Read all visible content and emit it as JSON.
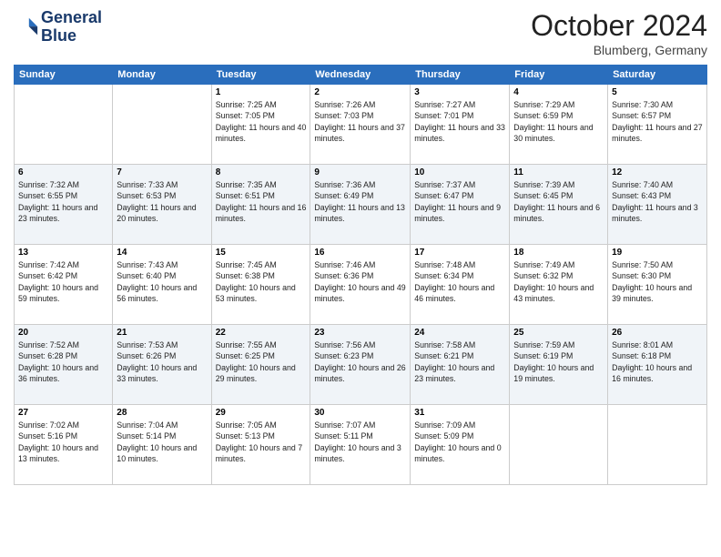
{
  "header": {
    "logo_line1": "General",
    "logo_line2": "Blue",
    "month": "October 2024",
    "location": "Blumberg, Germany"
  },
  "days_of_week": [
    "Sunday",
    "Monday",
    "Tuesday",
    "Wednesday",
    "Thursday",
    "Friday",
    "Saturday"
  ],
  "weeks": [
    [
      {
        "day": "",
        "info": ""
      },
      {
        "day": "",
        "info": ""
      },
      {
        "day": "1",
        "info": "Sunrise: 7:25 AM\nSunset: 7:05 PM\nDaylight: 11 hours and 40 minutes."
      },
      {
        "day": "2",
        "info": "Sunrise: 7:26 AM\nSunset: 7:03 PM\nDaylight: 11 hours and 37 minutes."
      },
      {
        "day": "3",
        "info": "Sunrise: 7:27 AM\nSunset: 7:01 PM\nDaylight: 11 hours and 33 minutes."
      },
      {
        "day": "4",
        "info": "Sunrise: 7:29 AM\nSunset: 6:59 PM\nDaylight: 11 hours and 30 minutes."
      },
      {
        "day": "5",
        "info": "Sunrise: 7:30 AM\nSunset: 6:57 PM\nDaylight: 11 hours and 27 minutes."
      }
    ],
    [
      {
        "day": "6",
        "info": "Sunrise: 7:32 AM\nSunset: 6:55 PM\nDaylight: 11 hours and 23 minutes."
      },
      {
        "day": "7",
        "info": "Sunrise: 7:33 AM\nSunset: 6:53 PM\nDaylight: 11 hours and 20 minutes."
      },
      {
        "day": "8",
        "info": "Sunrise: 7:35 AM\nSunset: 6:51 PM\nDaylight: 11 hours and 16 minutes."
      },
      {
        "day": "9",
        "info": "Sunrise: 7:36 AM\nSunset: 6:49 PM\nDaylight: 11 hours and 13 minutes."
      },
      {
        "day": "10",
        "info": "Sunrise: 7:37 AM\nSunset: 6:47 PM\nDaylight: 11 hours and 9 minutes."
      },
      {
        "day": "11",
        "info": "Sunrise: 7:39 AM\nSunset: 6:45 PM\nDaylight: 11 hours and 6 minutes."
      },
      {
        "day": "12",
        "info": "Sunrise: 7:40 AM\nSunset: 6:43 PM\nDaylight: 11 hours and 3 minutes."
      }
    ],
    [
      {
        "day": "13",
        "info": "Sunrise: 7:42 AM\nSunset: 6:42 PM\nDaylight: 10 hours and 59 minutes."
      },
      {
        "day": "14",
        "info": "Sunrise: 7:43 AM\nSunset: 6:40 PM\nDaylight: 10 hours and 56 minutes."
      },
      {
        "day": "15",
        "info": "Sunrise: 7:45 AM\nSunset: 6:38 PM\nDaylight: 10 hours and 53 minutes."
      },
      {
        "day": "16",
        "info": "Sunrise: 7:46 AM\nSunset: 6:36 PM\nDaylight: 10 hours and 49 minutes."
      },
      {
        "day": "17",
        "info": "Sunrise: 7:48 AM\nSunset: 6:34 PM\nDaylight: 10 hours and 46 minutes."
      },
      {
        "day": "18",
        "info": "Sunrise: 7:49 AM\nSunset: 6:32 PM\nDaylight: 10 hours and 43 minutes."
      },
      {
        "day": "19",
        "info": "Sunrise: 7:50 AM\nSunset: 6:30 PM\nDaylight: 10 hours and 39 minutes."
      }
    ],
    [
      {
        "day": "20",
        "info": "Sunrise: 7:52 AM\nSunset: 6:28 PM\nDaylight: 10 hours and 36 minutes."
      },
      {
        "day": "21",
        "info": "Sunrise: 7:53 AM\nSunset: 6:26 PM\nDaylight: 10 hours and 33 minutes."
      },
      {
        "day": "22",
        "info": "Sunrise: 7:55 AM\nSunset: 6:25 PM\nDaylight: 10 hours and 29 minutes."
      },
      {
        "day": "23",
        "info": "Sunrise: 7:56 AM\nSunset: 6:23 PM\nDaylight: 10 hours and 26 minutes."
      },
      {
        "day": "24",
        "info": "Sunrise: 7:58 AM\nSunset: 6:21 PM\nDaylight: 10 hours and 23 minutes."
      },
      {
        "day": "25",
        "info": "Sunrise: 7:59 AM\nSunset: 6:19 PM\nDaylight: 10 hours and 19 minutes."
      },
      {
        "day": "26",
        "info": "Sunrise: 8:01 AM\nSunset: 6:18 PM\nDaylight: 10 hours and 16 minutes."
      }
    ],
    [
      {
        "day": "27",
        "info": "Sunrise: 7:02 AM\nSunset: 5:16 PM\nDaylight: 10 hours and 13 minutes."
      },
      {
        "day": "28",
        "info": "Sunrise: 7:04 AM\nSunset: 5:14 PM\nDaylight: 10 hours and 10 minutes."
      },
      {
        "day": "29",
        "info": "Sunrise: 7:05 AM\nSunset: 5:13 PM\nDaylight: 10 hours and 7 minutes."
      },
      {
        "day": "30",
        "info": "Sunrise: 7:07 AM\nSunset: 5:11 PM\nDaylight: 10 hours and 3 minutes."
      },
      {
        "day": "31",
        "info": "Sunrise: 7:09 AM\nSunset: 5:09 PM\nDaylight: 10 hours and 0 minutes."
      },
      {
        "day": "",
        "info": ""
      },
      {
        "day": "",
        "info": ""
      }
    ]
  ]
}
